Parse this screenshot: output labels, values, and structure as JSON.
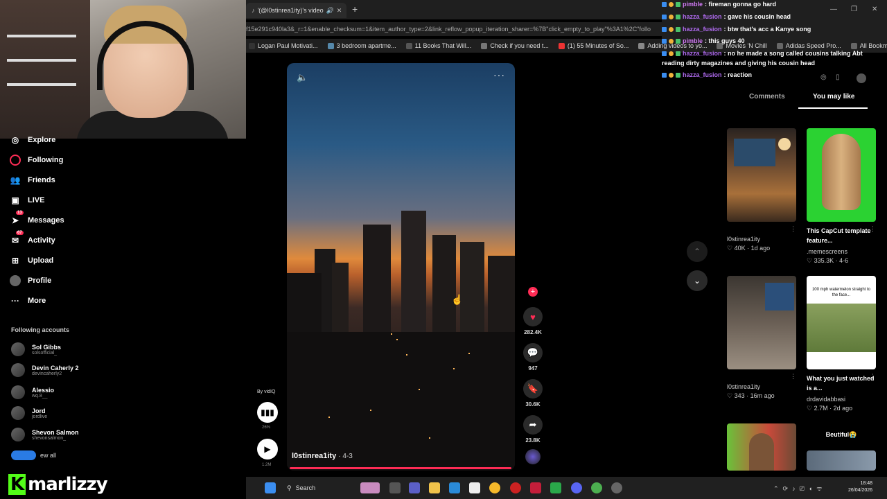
{
  "browser": {
    "tab_title": "'(@l0stinrea1ity)'s videos w",
    "url": "f15e291c940la3&_r=1&enable_checksum=1&item_author_type=2&link_reflow_popup_iteration_sharer=%7B\"click_empty_to_play\"%3A1%2C\"follo",
    "bookmarks": [
      "Logan Paul Motivati...",
      "3 bedroom apartme...",
      "11 Books That Will...",
      "Check if you need t...",
      "(1) 55 Minutes of So...",
      "Adding videos to yo...",
      "Movies 'N Chill",
      "Adidas Speed Pro...",
      "All Bookmarks"
    ]
  },
  "sidebar": {
    "items": [
      {
        "label": "Explore",
        "icon": "compass-icon"
      },
      {
        "label": "Following",
        "icon": "following-icon"
      },
      {
        "label": "Friends",
        "icon": "friends-icon"
      },
      {
        "label": "LIVE",
        "icon": "live-icon"
      },
      {
        "label": "Messages",
        "icon": "send-icon",
        "badge": "13"
      },
      {
        "label": "Activity",
        "icon": "inbox-icon",
        "badge": "67"
      },
      {
        "label": "Upload",
        "icon": "upload-icon"
      },
      {
        "label": "Profile",
        "icon": "avatar-icon"
      },
      {
        "label": "More",
        "icon": "ellipsis-icon"
      }
    ],
    "following_header": "Following accounts",
    "accounts": [
      {
        "name": "Sol Gibbs",
        "handle": "solsofficial_"
      },
      {
        "name": "Devin Caherly 2",
        "handle": "devincaherly2"
      },
      {
        "name": "Alessio",
        "handle": "wq.8__"
      },
      {
        "name": "Jord",
        "handle": "jordlive"
      },
      {
        "name": "Shevon Salmon",
        "handle": "shevonsalmon_"
      }
    ],
    "see_all": "ew all"
  },
  "watermark": {
    "k": "K",
    "name": "marlizzy"
  },
  "video": {
    "author": "l0stinrea1ity",
    "date": "· 4-3",
    "likes": "282.4K",
    "comments": "947",
    "saves": "30.6K",
    "shares": "23.8K"
  },
  "audio": {
    "by": "By vidIQ",
    "pct": "26%",
    "plays": "1.2M"
  },
  "chat": [
    {
      "user": "pimble",
      "text": ": fireman gonna go hard"
    },
    {
      "user": "hazza_fusion",
      "text": ": gave his cousin head"
    },
    {
      "user": "hazza_fusion",
      "text": ": btw that's acc a Kanye song"
    },
    {
      "user": "pimble",
      "text": ": this guys 40"
    },
    {
      "user": "hazza_fusion",
      "text": ": no he made a song called cousins talking Abt"
    },
    {
      "user": "hazza_fusion",
      "text": ": reaction"
    }
  ],
  "chat_continuation": "reading dirty magazines and giving his cousin head",
  "right_panel": {
    "tabs": [
      "Comments",
      "You may like"
    ],
    "cards": [
      {
        "title": "",
        "author": "l0stinrea1ity",
        "likes": "40K",
        "age": "1d ago"
      },
      {
        "title": "This CapCut template feature...",
        "author": ".memescreens",
        "likes": "335.3K",
        "age": "4-6"
      },
      {
        "title": "",
        "author": "l0stinrea1ity",
        "likes": "343",
        "age": "16m ago"
      },
      {
        "title": "What you just watched is a...",
        "author": "drdavidabbasi",
        "likes": "2.7M",
        "age": "2d ago"
      },
      {
        "title": "",
        "author": "",
        "likes": "",
        "age": ""
      },
      {
        "title": "Beutiful😭",
        "author": "",
        "likes": "",
        "age": ""
      }
    ],
    "thumb_caption": "100 mph watermelon straight to the face..."
  },
  "taskbar": {
    "search": "Search",
    "time": "18:48",
    "date": "26/04/2026"
  }
}
